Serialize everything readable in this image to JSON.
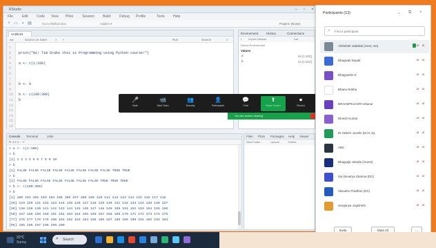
{
  "rstudio": {
    "menu": [
      "File",
      "Edit",
      "Code",
      "View",
      "Plots",
      "Session",
      "Build",
      "Debug",
      "Profile",
      "Tools",
      "Help"
    ],
    "project": "Project: (None)",
    "editor": {
      "tab": "Untitled1",
      "tool_labels": [
        "Source on Save",
        "Run",
        "Source"
      ],
      "lines": [
        "",
        "print(\"Hi! Tim Drake this is Programming  using  Python  course!\")",
        "",
        "a <- c(1:100)",
        "",
        "",
        "",
        "b <- 0",
        "",
        "b <- c(100:300)",
        "b",
        "",
        "",
        ""
      ],
      "line_numbers": [
        "1",
        "2",
        "3",
        "4",
        "5",
        "6",
        "7",
        "8",
        "9",
        "10",
        "11",
        "12",
        "13",
        "14",
        "15",
        "16"
      ]
    },
    "console": {
      "tabs": [
        "Console",
        "Terminal",
        "Jobs"
      ],
      "path": "R 4.2.1 · ~/",
      "lines": [
        "> a <- c(1:100)",
        "> b",
        "[1]   1  2  3  4  5  6  7  8  9 10",
        "> b",
        "[1] FALSE FALSE FALSE FALSE FALSE FALSE FALSE FALSE  TRUE  TRUE",
        "> b",
        "[1] FALSE FALSE FALSE FALSE FALSE FALSE FALSE  TRUE  TRUE  TRUE",
        "> b <- c(100:300)",
        "> b",
        "[1] 100 101 102 103 104 105 106 107 108 109 110 111 112 113 114 115 116 117 118",
        "[20] 119 120 121 122 123 124 125 126 127 128 129 130 131 132 133 134 135 136 137",
        "[39] 138 139 140 141 142 143 144 145 146 147 148 149 150 151 152 153 154 155 156",
        "[58] 157 158 159 160 161 162 163 164 165 166 167 168 169 170 171 172 173 174 175",
        "[77] 176 177 178 179 180 181 182 183 184 185 186 187 188 189 190 191 192 193 194",
        "[96] 195 196 197 198 199 200"
      ]
    },
    "environment": {
      "tabs": [
        "Environment",
        "History",
        "Connections"
      ],
      "tools": [
        "Import Dataset",
        "List"
      ],
      "scope": "Global Environment",
      "section": "Values",
      "rows": [
        {
          "name": "a",
          "value": "int [1:100]"
        },
        {
          "name": "b",
          "value": "int [1:201]"
        }
      ]
    },
    "files": {
      "tabs": [
        "Files",
        "Plots",
        "Packages",
        "Help",
        "Viewer"
      ],
      "tools": [
        "New Folder",
        "Upload",
        "Delete"
      ]
    }
  },
  "zoom": {
    "toolbar": [
      {
        "icon": "🎤",
        "label": "Mute"
      },
      {
        "icon": "📹",
        "label": "Start Video"
      },
      {
        "icon": "👥",
        "label": "Security"
      },
      {
        "icon": "👤",
        "label": "Participants"
      },
      {
        "icon": "💬",
        "label": "Chat"
      },
      {
        "icon": "⬆",
        "label": "Share Screen"
      },
      {
        "icon": "⏺",
        "label": "Record"
      }
    ],
    "banner": "You are screen sharing"
  },
  "participants_panel": {
    "title": "Participants (13)",
    "search_placeholder": "Find a participant",
    "members": [
      {
        "name": "Abhishek Vaddadi (Host, me)",
        "color": "#7a8a96",
        "highlight": true
      },
      {
        "name": "Bhagwati Nayak",
        "color": "#3b6bd6"
      },
      {
        "name": "Bhagyashri K",
        "color": "#7a4ec7"
      },
      {
        "name": "Bhanu Rekha",
        "color": "#ffffff"
      },
      {
        "name": "BRAHMTEJASRI Uttanur",
        "color": "#6a3fc2"
      },
      {
        "name": "Dinesh Kumar",
        "color": "#8a5fd2"
      },
      {
        "name": "Dr.Hebert Juvelin (Dr.H.Jx)",
        "color": "#1f9c5a"
      },
      {
        "name": "ABC",
        "color": "#2b3440"
      },
      {
        "name": "Bhagyajit Jalodia (Guest)",
        "color": "#1a2e80"
      },
      {
        "name": "Sai Devarya Sharma (DC)",
        "color": "#3f4fcf"
      },
      {
        "name": "Vasudev Pradhan (DC)",
        "color": "#235cc0"
      },
      {
        "name": "Sowjanya Jogishetti",
        "color": "#e39a30"
      }
    ],
    "invite_label": "Invite",
    "mute_all_label": "Mute All",
    "more_label": "..."
  },
  "taskbar": {
    "search_label": "Search",
    "weather_line1": "31°C",
    "weather_line2": "Sunny"
  }
}
